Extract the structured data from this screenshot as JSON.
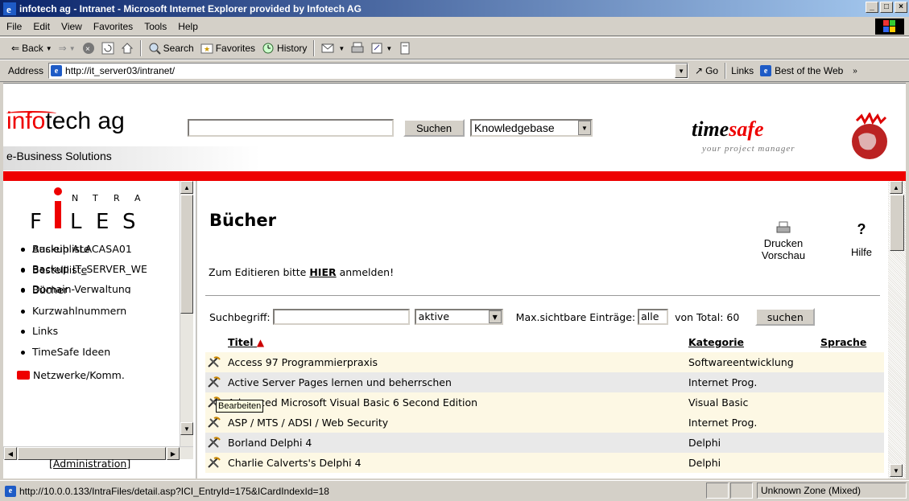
{
  "window": {
    "title": "infotech ag - Intranet - Microsoft Internet Explorer provided by Infotech AG"
  },
  "menu": [
    "File",
    "Edit",
    "View",
    "Favorites",
    "Tools",
    "Help"
  ],
  "toolbar": {
    "back": "Back",
    "search": "Search",
    "favorites": "Favorites",
    "history": "History"
  },
  "address": {
    "label": "Address",
    "url": "http://it_server03/intranet/",
    "go": "Go",
    "links": "Links",
    "best": "Best of the Web"
  },
  "header": {
    "brand_red": "info",
    "brand_rest": "tech ag",
    "tagline": "e-Business Solutions",
    "search_button": "Suchen",
    "search_scope": "Knowledgebase",
    "ts_time": "time",
    "ts_safe": "safe",
    "ts_sub": "your project manager"
  },
  "sidebar": {
    "logo_top": "N T R A",
    "logo_bottom": "F  L E S",
    "items": [
      "Ausleihliste",
      "Bestellliste",
      "Bücher",
      "Kurzwahlnummern",
      "Links",
      "TimeSafe Ideen"
    ],
    "folder": "Netzwerke/Komm.",
    "sub_items": [
      "Backup ALACASA01",
      "Backup IT_SERVER_WE",
      "Domain-Verwaltung"
    ],
    "admin": "[Administration]"
  },
  "content": {
    "title": "Bücher",
    "edit_pre": "Zum Editieren bitte ",
    "edit_link": "HIER",
    "edit_post": " anmelden!",
    "print_l1": "Drucken",
    "print_l2": "Vorschau",
    "help_q": "?",
    "help": "Hilfe"
  },
  "filter": {
    "label": "Suchbegriff:",
    "status": "aktive",
    "max_label": "Max.sichtbare Einträge:",
    "max_value": "alle",
    "total": "von Total: 60",
    "button": "suchen"
  },
  "table": {
    "columns": [
      "Titel",
      "Kategorie",
      "Sprache"
    ],
    "sort_arrow": "▲",
    "rows": [
      {
        "title": "Access 97 Programmierpraxis",
        "cat": "Softwareentwicklung",
        "lang": ""
      },
      {
        "title": "Active Server Pages lernen und beherrschen",
        "cat": "Internet Prog.",
        "lang": ""
      },
      {
        "title": "Advanced Microsoft Visual Basic 6 Second Edition",
        "cat": "Visual Basic",
        "lang": ""
      },
      {
        "title": "ASP / MTS / ADSI / Web Security",
        "cat": "Internet Prog.",
        "lang": ""
      },
      {
        "title": "Borland Delphi 4",
        "cat": "Delphi",
        "lang": ""
      },
      {
        "title": "Charlie Calverts's Delphi 4",
        "cat": "Delphi",
        "lang": ""
      }
    ]
  },
  "tooltip": "Bearbeiten",
  "status": {
    "url": "http://10.0.0.133/IntraFiles/detail.asp?ICI_EntryId=175&ICardIndexId=18",
    "zone": "Unknown Zone (Mixed)"
  }
}
